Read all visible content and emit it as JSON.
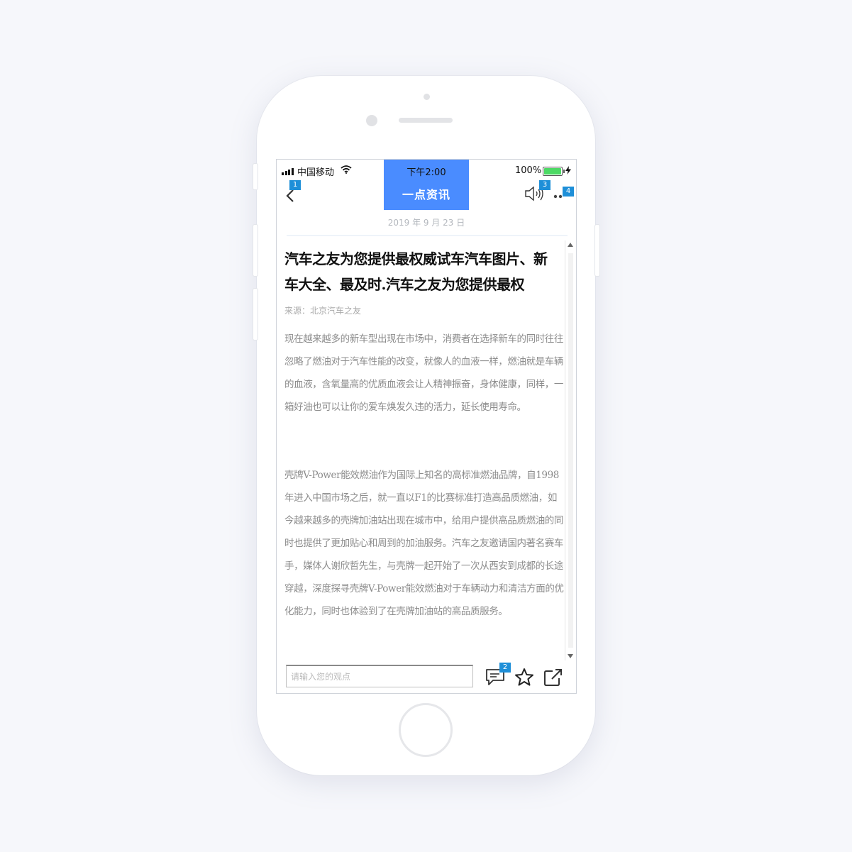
{
  "status_bar": {
    "carrier": "中国移动",
    "time": "下午2:00",
    "battery": "100%"
  },
  "nav": {
    "title": "一点资讯",
    "badges": {
      "back": "1",
      "comment": "2",
      "volume": "3",
      "more": "4"
    }
  },
  "article": {
    "date": "2019 年 9 月 23 日",
    "headline": "汽车之友为您提供最权威试车汽车图片、新车大全、最及时.汽车之友为您提供最权",
    "source": "来源：北京汽车之友",
    "paragraphs": [
      "现在越来越多的新车型出现在市场中，消费者在选择新车的同时往往忽略了燃油对于汽车性能的改变，就像人的血液一样，燃油就是车辆的血液，含氧量高的优质血液会让人精神振奋，身体健康，同样，一箱好油也可以让你的爱车焕发久违的活力，延长使用寿命。",
      "壳牌V-Power能效燃油作为国际上知名的高标准燃油品牌，自1998年进入中国市场之后，就一直以F1的比赛标准打造高品质燃油，如今越来越多的壳牌加油站出现在城市中，给用户提供高品质燃油的同时也提供了更加贴心和周到的加油服务。汽车之友邀请国内著名赛车手，媒体人谢欣哲先生，与壳牌一起开始了一次从西安到成都的长途穿越，深度探寻壳牌V-Power能效燃油对于车辆动力和清洁方面的优化能力，同时也体验到了在壳牌加油站的高品质服务。"
    ]
  },
  "bottom_bar": {
    "comment_placeholder": "请输入您的观点",
    "comment_value": ""
  },
  "icons": [
    "back-icon",
    "volume-icon",
    "more-icon",
    "comment-icon",
    "star-icon",
    "share-icon",
    "wifi-icon",
    "battery-icon",
    "charging-icon",
    "signal-icon"
  ],
  "colors": {
    "accent": "#4a8cff",
    "badge": "#1e8fd8",
    "battery": "#4cd964"
  }
}
